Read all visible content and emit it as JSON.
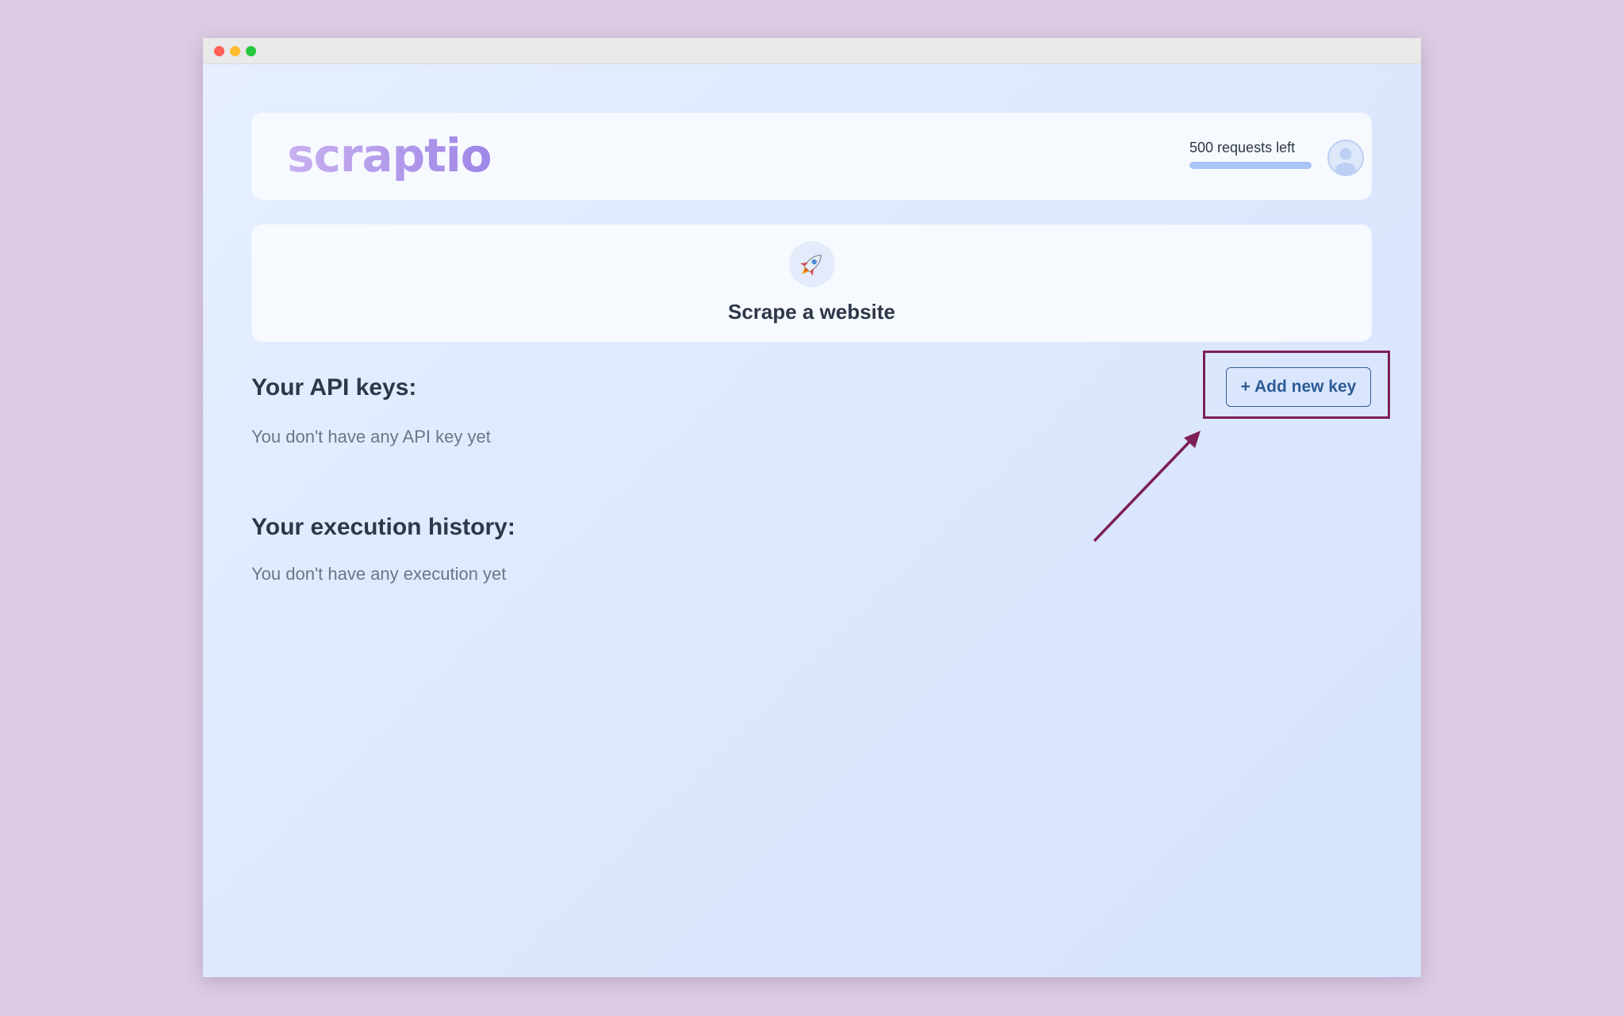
{
  "header": {
    "logo": "scraptio",
    "requests_label": "500 requests left",
    "requests_fraction": 1.0
  },
  "scrape": {
    "title": "Scrape a website",
    "icon": "rocket-icon"
  },
  "api_keys": {
    "title": "Your API keys:",
    "empty": "You don't have any API key yet",
    "add_button": "+ Add new key"
  },
  "history": {
    "title": "Your execution history:",
    "empty": "You don't have any execution yet"
  },
  "colors": {
    "annotation": "#7d1f56",
    "accent": "#2c5c96",
    "background": "#dccbe2"
  }
}
